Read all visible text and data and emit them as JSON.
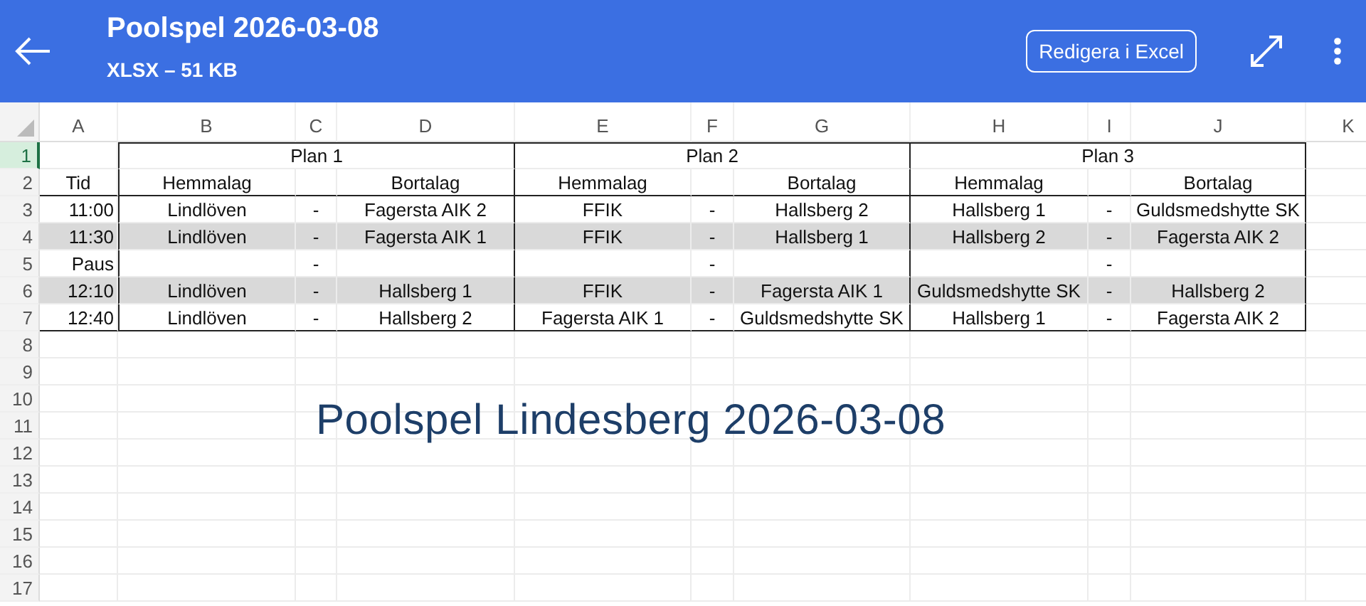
{
  "app_bar": {
    "title": "Poolspel 2026-03-08",
    "subtitle": "XLSX – 51 KB",
    "edit_button": "Redigera i Excel"
  },
  "sheet": {
    "columns": [
      "A",
      "B",
      "C",
      "D",
      "E",
      "F",
      "G",
      "H",
      "I",
      "J",
      "K"
    ],
    "rows": [
      {
        "number": "1",
        "selected": true,
        "shaded": false,
        "kind": "group",
        "cells": [
          "",
          "",
          "Plan 1",
          "",
          "",
          "Plan 2",
          "",
          "",
          "Plan 3",
          ""
        ]
      },
      {
        "number": "2",
        "selected": false,
        "shaded": false,
        "kind": "header",
        "cells": [
          "Tid",
          "Hemmalag",
          "",
          "Bortalag",
          "Hemmalag",
          "",
          "Bortalag",
          "Hemmalag",
          "",
          "Bortalag"
        ]
      },
      {
        "number": "3",
        "selected": false,
        "shaded": false,
        "kind": "match",
        "cells": [
          "11:00",
          "Lindlöven",
          "-",
          "Fagersta AIK 2",
          "FFIK",
          "-",
          "Hallsberg 2",
          "Hallsberg 1",
          "-",
          "Guldsmedshytte SK"
        ]
      },
      {
        "number": "4",
        "selected": false,
        "shaded": true,
        "kind": "match",
        "cells": [
          "11:30",
          "Lindlöven",
          "-",
          "Fagersta AIK 1",
          "FFIK",
          "-",
          "Hallsberg 1",
          "Hallsberg 2",
          "-",
          "Fagersta AIK 2"
        ]
      },
      {
        "number": "5",
        "selected": false,
        "shaded": false,
        "kind": "match",
        "cells": [
          "Paus",
          "",
          "-",
          "",
          "",
          "-",
          "",
          "",
          "-",
          ""
        ]
      },
      {
        "number": "6",
        "selected": false,
        "shaded": true,
        "kind": "match",
        "cells": [
          "12:10",
          "Lindlöven",
          "-",
          "Hallsberg 1",
          "FFIK",
          "-",
          "Fagersta AIK 1",
          "Guldsmedshytte SK",
          "-",
          "Hallsberg 2"
        ]
      },
      {
        "number": "7",
        "selected": false,
        "shaded": false,
        "kind": "match",
        "cells": [
          "12:40",
          "Lindlöven",
          "-",
          "Hallsberg 2",
          "Fagersta AIK 1",
          "-",
          "Guldsmedshytte SK",
          "Hallsberg 1",
          "-",
          "Fagersta AIK 2"
        ]
      },
      {
        "number": "8",
        "selected": false,
        "shaded": false,
        "kind": "empty",
        "cells": []
      },
      {
        "number": "9",
        "selected": false,
        "shaded": false,
        "kind": "empty",
        "cells": []
      },
      {
        "number": "10",
        "selected": false,
        "shaded": false,
        "kind": "empty",
        "cells": []
      },
      {
        "number": "11",
        "selected": false,
        "shaded": false,
        "kind": "empty",
        "cells": []
      },
      {
        "number": "12",
        "selected": false,
        "shaded": false,
        "kind": "empty",
        "cells": []
      },
      {
        "number": "13",
        "selected": false,
        "shaded": false,
        "kind": "empty",
        "cells": []
      },
      {
        "number": "14",
        "selected": false,
        "shaded": false,
        "kind": "empty",
        "cells": []
      },
      {
        "number": "15",
        "selected": false,
        "shaded": false,
        "kind": "empty",
        "cells": []
      },
      {
        "number": "16",
        "selected": false,
        "shaded": false,
        "kind": "empty",
        "cells": []
      },
      {
        "number": "17",
        "selected": false,
        "shaded": false,
        "kind": "empty",
        "cells": []
      }
    ],
    "text_box": "Poolspel Lindesberg 2026-03-08"
  }
}
